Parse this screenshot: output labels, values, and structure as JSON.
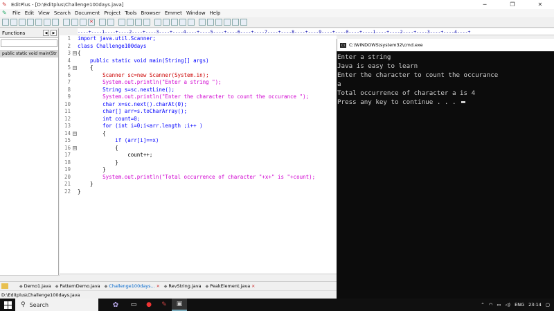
{
  "window": {
    "title": "EditPlus - [D:\\Editplus\\Challenge100days.java]",
    "minimize": "─",
    "restore": "❐",
    "close": "✕"
  },
  "menu": [
    "File",
    "Edit",
    "View",
    "Search",
    "Document",
    "Project",
    "Tools",
    "Browser",
    "Emmet",
    "Window",
    "Help"
  ],
  "left_panel": {
    "header": "Functions",
    "prev_arrow": "◀",
    "next_arrow": "▶",
    "function_item": "public static void main(Str"
  },
  "ruler": "----+----1----+----2----+----3----+----4----+----5----+----6----+----7----+----8----+----9----+----0----+----1----+----2----+----3----+----4----+",
  "code_lines": [
    "import java.util.Scanner;",
    "class Challenge100days",
    "{",
    "    public static void main(String[] args)",
    "    {",
    "        Scanner sc=new Scanner(System.in);",
    "        System.out.println(\"Enter a string \");",
    "        String s=sc.nextLine();",
    "        System.out.println(\"Enter the character to count the occurance \");",
    "        char x=sc.next().charAt(0);",
    "        char[] arr=s.toCharArray();",
    "        int count=0;",
    "        for (int i=0;i<arr.length ;i++ )",
    "        {",
    "            if (arr[i]==x)",
    "            {",
    "                count++;",
    "            }",
    "        }",
    "        System.out.println(\"Total occurrence of character \"+x+\" is \"+count);",
    "    }",
    "}"
  ],
  "line_numbers": [
    "1",
    "2",
    "3",
    "4",
    "5",
    "6",
    "7",
    "8",
    "9",
    "10",
    "11",
    "12",
    "13",
    "14",
    "15",
    "16",
    "17",
    "18",
    "19",
    "20",
    "21",
    "22"
  ],
  "fold_marker": "⊟",
  "tabs": [
    {
      "label": "Demo1.java",
      "active": false
    },
    {
      "label": "PatternDemo.java",
      "active": false
    },
    {
      "label": "Challenge100days...",
      "active": true
    },
    {
      "label": "RevString.java",
      "active": false
    },
    {
      "label": "PeakElement.java",
      "active": false
    }
  ],
  "tab_close": "✕",
  "status_path": "D:\\Editplus\\Challenge100days.java",
  "cmd": {
    "title": "C:\\WINDOWS\\system32\\cmd.exe",
    "lines": [
      "Enter a string",
      "Java is easy to learn",
      "Enter the character to count the occurance",
      "a",
      "Total occurrence of character a is 4",
      "Press any key to continue . . . "
    ]
  },
  "taskbar": {
    "search_label": "Search",
    "tray_lang": "ENG",
    "tray_time": "23:14"
  }
}
